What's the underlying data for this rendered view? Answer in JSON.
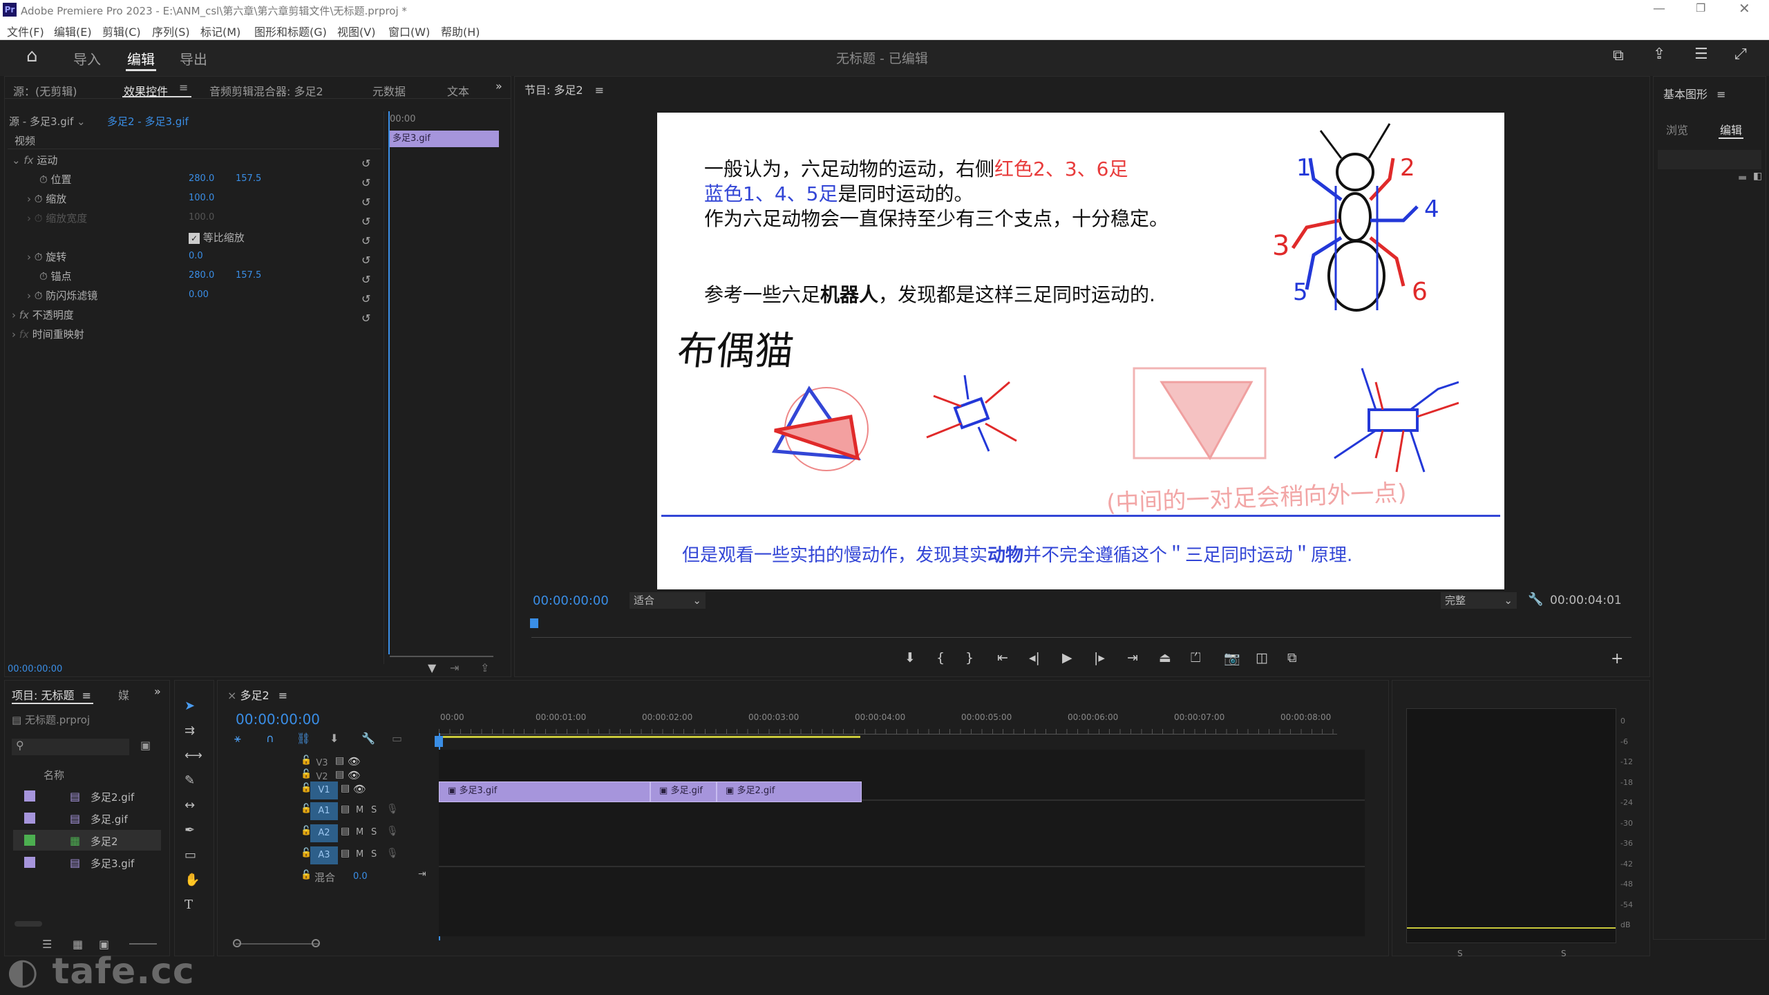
{
  "app": {
    "title": "Adobe Premiere Pro 2023 - E:\\ANM_csl\\第六章\\第六章剪辑文件\\无标题.prproj *",
    "logo": "Pr"
  },
  "menu": [
    "文件(F)",
    "编辑(E)",
    "剪辑(C)",
    "序列(S)",
    "标记(M)",
    "图形和标题(G)",
    "视图(V)",
    "窗口(W)",
    "帮助(H)"
  ],
  "workspace": {
    "tabs": [
      "导入",
      "编辑",
      "导出"
    ],
    "active": "编辑",
    "project_title": "无标题 - 已编辑"
  },
  "effects_panel": {
    "tabs": [
      "源：(无剪辑)",
      "效果控件",
      "音频剪辑混合器: 多足2",
      "元数据",
      "文本"
    ],
    "source_label": "源 - 多足3.gif",
    "sequence_label": "多足2 - 多足3.gif",
    "section_video": "视频",
    "mini_timecode": "00:00",
    "mini_clip": "多足3.gif",
    "rows": [
      {
        "label": "运动",
        "fx": true
      },
      {
        "label": "位置",
        "v1": "280.0",
        "v2": "157.5"
      },
      {
        "label": "缩放",
        "v1": "100.0"
      },
      {
        "label": "缩放宽度",
        "v1": "100.0",
        "disabled": true
      },
      {
        "label": "等比缩放",
        "checkbox": true
      },
      {
        "label": "旋转",
        "v1": "0.0"
      },
      {
        "label": "锚点",
        "v1": "280.0",
        "v2": "157.5"
      },
      {
        "label": "防闪烁滤镜",
        "v1": "0.00"
      },
      {
        "label": "不透明度",
        "fx": true
      },
      {
        "label": "时间重映射",
        "fx": true
      }
    ],
    "footer_timecode": "00:00:00:00"
  },
  "program_monitor": {
    "title": "节目: 多足2",
    "timecode": "00:00:00:00",
    "fit": "适合",
    "quality": "完整",
    "duration": "00:00:04:01",
    "frame": {
      "line1a": "一般认为，六足动物的运动，右侧",
      "line1b": "红色2、3、6足",
      "line2a": "蓝色1、4、5足",
      "line2b": "是同时运动的。",
      "line3": "作为六足动物会一直保持至少有三个支点，十分稳定。",
      "line4a": "参考一些六足",
      "line4b": "机器人",
      "line4c": "，发现都是这样三足同时运动的.",
      "handwrite1": "布偶猫",
      "handwrite2": "(中间的一对足会稍向外一点)",
      "leg_numbers": [
        "1",
        "2",
        "3",
        "4",
        "5",
        "6"
      ],
      "bottom_a": "但是观看一些实拍的慢动作，发现其实",
      "bottom_b": "动物",
      "bottom_c": "并不完全遵循这个＂三足同时运动＂原理."
    }
  },
  "right_panel": {
    "title": "基本图形",
    "tabs": [
      "浏览",
      "编辑"
    ]
  },
  "project_panel": {
    "tabs": [
      "项目: 无标题",
      "媒"
    ],
    "file": "无标题.prproj",
    "column": "名称",
    "items": [
      {
        "name": "多足2.gif",
        "color": "#a695dc"
      },
      {
        "name": "多足.gif",
        "color": "#a695dc"
      },
      {
        "name": "多足2",
        "color": "#4caf50"
      },
      {
        "name": "多足3.gif",
        "color": "#a695dc"
      }
    ]
  },
  "timeline": {
    "tab": "多足2",
    "timecode": "00:00:00:00",
    "ruler": [
      "00:00",
      "00:00:01:00",
      "00:00:02:00",
      "00:00:03:00",
      "00:00:04:00",
      "00:00:05:00",
      "00:00:06:00",
      "00:00:07:00",
      "00:00:08:00"
    ],
    "tracks": [
      "V3",
      "V2",
      "V1",
      "A1",
      "A2",
      "A3"
    ],
    "mix_label": "混合",
    "mix_value": "0.0",
    "clips": [
      {
        "name": "多足3.gif"
      },
      {
        "name": "多足.gif"
      },
      {
        "name": "多足2.gif"
      }
    ]
  },
  "audio_meter": {
    "scale": [
      "0",
      "-6",
      "-12",
      "-18",
      "-24",
      "-30",
      "-36",
      "-42",
      "-48",
      "-54",
      "dB"
    ],
    "solo": [
      "S",
      "S"
    ]
  },
  "watermark": "tafe.cc"
}
